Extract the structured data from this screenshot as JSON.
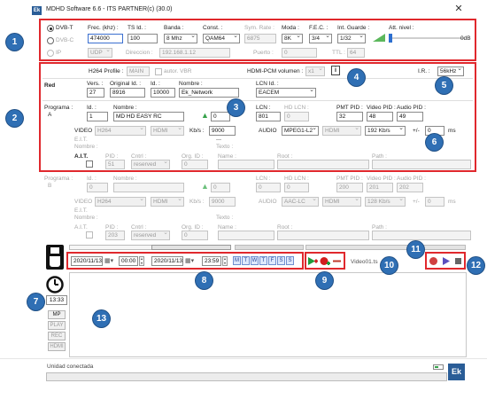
{
  "window": {
    "title": "MDHD Software 6.6 - ITS PARTNER(c) (30.0)",
    "logo": "Ek",
    "close_icon": "close-icon"
  },
  "badges": [
    "1",
    "2",
    "3",
    "4",
    "5",
    "6",
    "7",
    "8",
    "9",
    "10",
    "11",
    "12",
    "13"
  ],
  "tuner": {
    "dvbt": "DVB-T",
    "dvbc": "DVB-C",
    "ip": "IP",
    "freq_label": "Frec. (khz) :",
    "freq_value": "474000",
    "tsid_label": "TS Id. :",
    "tsid_value": "100",
    "banda_label": "Banda :",
    "banda_value": "8 Mhz",
    "const_label": "Const. :",
    "const_value": "QAM64",
    "symrate_label": "Sym. Rate :",
    "symrate_value": "6875",
    "moda_label": "Moda :",
    "moda_value": "8K",
    "fec_label": "F.E.C. :",
    "fec_value": "3/4",
    "guarde_label": "Int. Guarde :",
    "guarde_value": "1/32",
    "att_label": "Att. nivel :",
    "att_unit": "0dB",
    "att_level": 0,
    "ip_proto": "UDP",
    "dir_label": "Direccion :",
    "dir_value": "192.168.1.12",
    "puerto_label": "Puerto :",
    "puerto_value": "0",
    "ttl_label": "TTL :",
    "ttl_value": "64"
  },
  "program_a": {
    "h264_label": "H264 Profile :",
    "h264_value": "MAIN",
    "autor_label": "autor. VBR",
    "hdmi_label": "HDMI-PCM volumen :",
    "hdmi_value": "x1",
    "ir_label": "I.R. :",
    "ir_value": "56kHz",
    "red_label": "Red",
    "vers_label": "Vers. :",
    "vers_value": "27",
    "origid_label": "Original Id. :",
    "origid_value": "8916",
    "id_label": "Id. :",
    "id_value": "10000",
    "nombre_label": "Nombre :",
    "nombre_value": "Ek_Network",
    "lcnid_label": "LCN Id. :",
    "lcnid_value": "EACEM",
    "programa_label": "Programa :",
    "programa_letter": "A",
    "prog_id_label": "Id. :",
    "prog_id_value": "1",
    "prog_nombre_label": "Nombre :",
    "prog_nombre_value": "MD HD EASY RC",
    "prog_num": "0",
    "lcn_label": "LCN :",
    "lcn_value": "801",
    "hdlcn_label": "HD LCN :",
    "hdlcn_value": "0",
    "pmt_label": "PMT PID :",
    "pmt_value": "32",
    "vpid_label": "Video PID :",
    "vpid_value": "48",
    "apid_label": "Audio PID :",
    "apid_value": "49",
    "video_label": "VIDEO",
    "video_codec": "H264",
    "video_out": "HDMI",
    "kbs_label": "Kb/s :",
    "kbs_value": "9000",
    "audio_label": "AUDIO",
    "audio_codec": "MPEG1-L2",
    "audio_out": "HDMI",
    "audio_rate": "192 Kb/s",
    "pm_label": "+/-",
    "ms_value": "0",
    "ms_label": "ms",
    "eit_label": "E.I.T.",
    "eit_nombre": "Nombre :",
    "eit_texto": "Texto :",
    "ait_label": "A.I.T.",
    "pid_label": "PID :",
    "pid_value": "51",
    "cntrl_label": "Cntrl :",
    "cntrl_value": "reserved",
    "org_label": "Org. ID :",
    "org_value": "0",
    "name_label": "Name :",
    "root_label": "Root :",
    "path_label": "Path :"
  },
  "program_b": {
    "programa_label": "Programa :",
    "programa_letter": "B",
    "id_label": "Id. :",
    "id_value": "0",
    "nombre_label": "Nombre :",
    "prog_num": "0",
    "lcn_label": "LCN :",
    "lcn_value": "0",
    "hdlcn_label": "HD LCN :",
    "hdlcn_value": "0",
    "pmt_label": "PMT PID :",
    "pmt_value": "200",
    "vpid_label": "Video PID :",
    "vpid_value": "201",
    "apid_label": "Audio PID :",
    "apid_value": "202",
    "video_label": "VIDEO",
    "video_codec": "H264",
    "video_out": "HDMI",
    "kbs_label": "Kb/s :",
    "kbs_value": "9000",
    "audio_label": "AUDIO",
    "audio_codec": "AAC-LC",
    "audio_out": "HDMI",
    "audio_rate": "128 Kb/s",
    "pm_label": "+/-",
    "ms_value": "0",
    "ms_label": "ms",
    "eit_label": "E.I.T.",
    "eit_nombre": "Nombre :",
    "eit_texto": "Texto :",
    "ait_label": "A.I.T.",
    "pid_label": "PID :",
    "pid_value": "203",
    "cntrl_label": "Cntrl :",
    "cntrl_value": "reserved",
    "org_label": "Org. ID :",
    "org_value": "0",
    "name_label": "Name :",
    "root_label": "Root :",
    "path_label": "Path :"
  },
  "recorder": {
    "start_date": "2020/11/13",
    "start_time": "00:00",
    "end_date": "2020/11/13",
    "end_time": "23:59",
    "days": [
      "M",
      "T",
      "W",
      "T",
      "F",
      "S",
      "S"
    ],
    "clock": "13:33",
    "side_buttons": [
      "MP",
      "PLAY",
      "REC",
      "HDMI"
    ],
    "file": "Video01.ts"
  },
  "status": {
    "text": "Unidad conectada",
    "logo": "Ek"
  },
  "colors": {
    "highlight": "#e0282d",
    "badge": "#2f6fb4",
    "ok_green": "#35a24a"
  }
}
